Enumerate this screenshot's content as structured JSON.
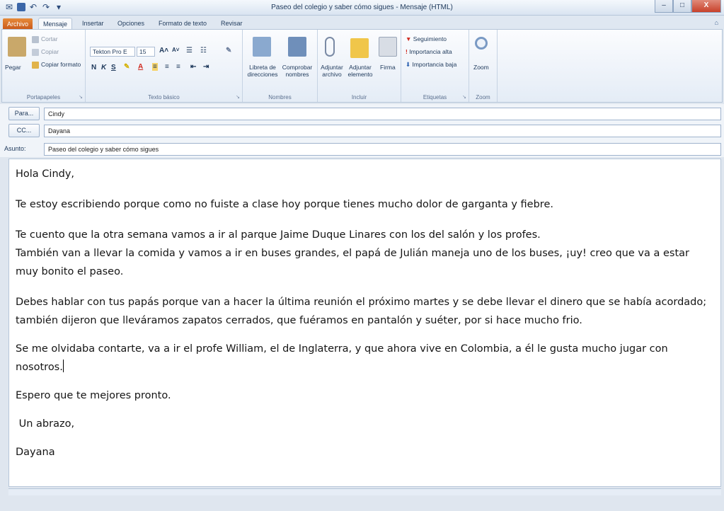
{
  "window": {
    "title": "Paseo del colegio y saber cómo sigues  -  Mensaje (HTML)",
    "controls": [
      "–",
      "□",
      "X"
    ]
  },
  "tabs": {
    "file": "Archivo",
    "mensaje": "Mensaje",
    "insertar": "Insertar",
    "opciones": "Opciones",
    "formato": "Formato de texto",
    "revisar": "Revisar"
  },
  "ribbon": {
    "portapapeles": {
      "pegar": "Pegar",
      "cortar": "Cortar",
      "copiar": "Copiar",
      "copiar_formato": "Copiar formato",
      "label": "Portapapeles"
    },
    "texto_basico": {
      "font": "Tekton Pro E",
      "size": "15",
      "bold": "N",
      "italic": "K",
      "underline": "S",
      "label": "Texto básico"
    },
    "nombres": {
      "libreta": "Libreta de direcciones",
      "comprobar": "Comprobar nombres",
      "label": "Nombres"
    },
    "incluir": {
      "adjuntar_archivo": "Adjuntar archivo",
      "adjuntar_elemento": "Adjuntar elemento",
      "firma": "Firma",
      "label": "Incluir"
    },
    "etiquetas": {
      "seguimiento": "Seguimiento",
      "alta": "Importancia alta",
      "baja": "Importancia baja",
      "label": "Etiquetas"
    },
    "zoom": {
      "zoom": "Zoom",
      "label": "Zoom"
    }
  },
  "header": {
    "para_label": "Para...",
    "para_value": "Cindy",
    "cc_label": "CC...",
    "cc_value": "Dayana",
    "asunto_label": "Asunto:",
    "asunto_value": "Paseo del colegio y saber cómo sigues"
  },
  "body": {
    "greeting": "Hola Cindy,",
    "p1": "Te estoy escribiendo porque como no fuiste a clase hoy porque tienes mucho dolor de garganta y fiebre.",
    "p2a": "Te cuento que la otra semana vamos a ir al parque Jaime Duque Linares con los del salón y los profes.",
    "p2b": "También van a llevar la comida y vamos a ir en buses grandes, el papá de Julián maneja uno de los buses, ¡uy! creo que va a estar muy bonito el paseo.",
    "p3": "Debes hablar con tus papás porque van a hacer la última reunión el próximo martes y se debe llevar el dinero que se había acordado; también dijeron que lleváramos zapatos cerrados, que fuéramos en pantalón y suéter, por si hace mucho frio.",
    "p4": "Se me olvidaba contarte, va a ir el profe William, el de Inglaterra, y  que ahora vive en Colombia, a él le gusta mucho jugar con nosotros.",
    "p5": "Espero que te mejores pronto.",
    "closing": " Un abrazo,",
    "signature": "Dayana"
  }
}
